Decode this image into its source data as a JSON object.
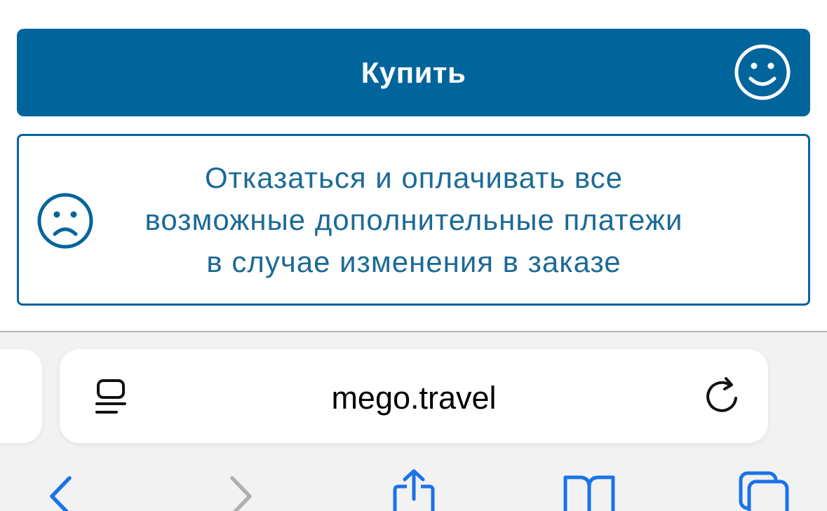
{
  "page": {
    "buy_button_label": "Купить",
    "decline_option": {
      "line1": "Отказаться и оплачивать все",
      "line2": "возможные дополнительные платежи",
      "line3": "в случае изменения в заказе"
    }
  },
  "browser": {
    "url": "mego.travel",
    "icons": {
      "reader": "reader-mode-icon",
      "reload": "reload-icon",
      "back": "back-chevron-icon",
      "forward": "forward-chevron-icon",
      "share": "share-icon",
      "bookmarks": "bookmarks-icon",
      "tabs": "tabs-icon"
    }
  },
  "colors": {
    "primary": "#01659c",
    "decline_text": "#1c6a96",
    "browser_accent": "#1a73e8",
    "disabled": "#b0b0b0"
  }
}
